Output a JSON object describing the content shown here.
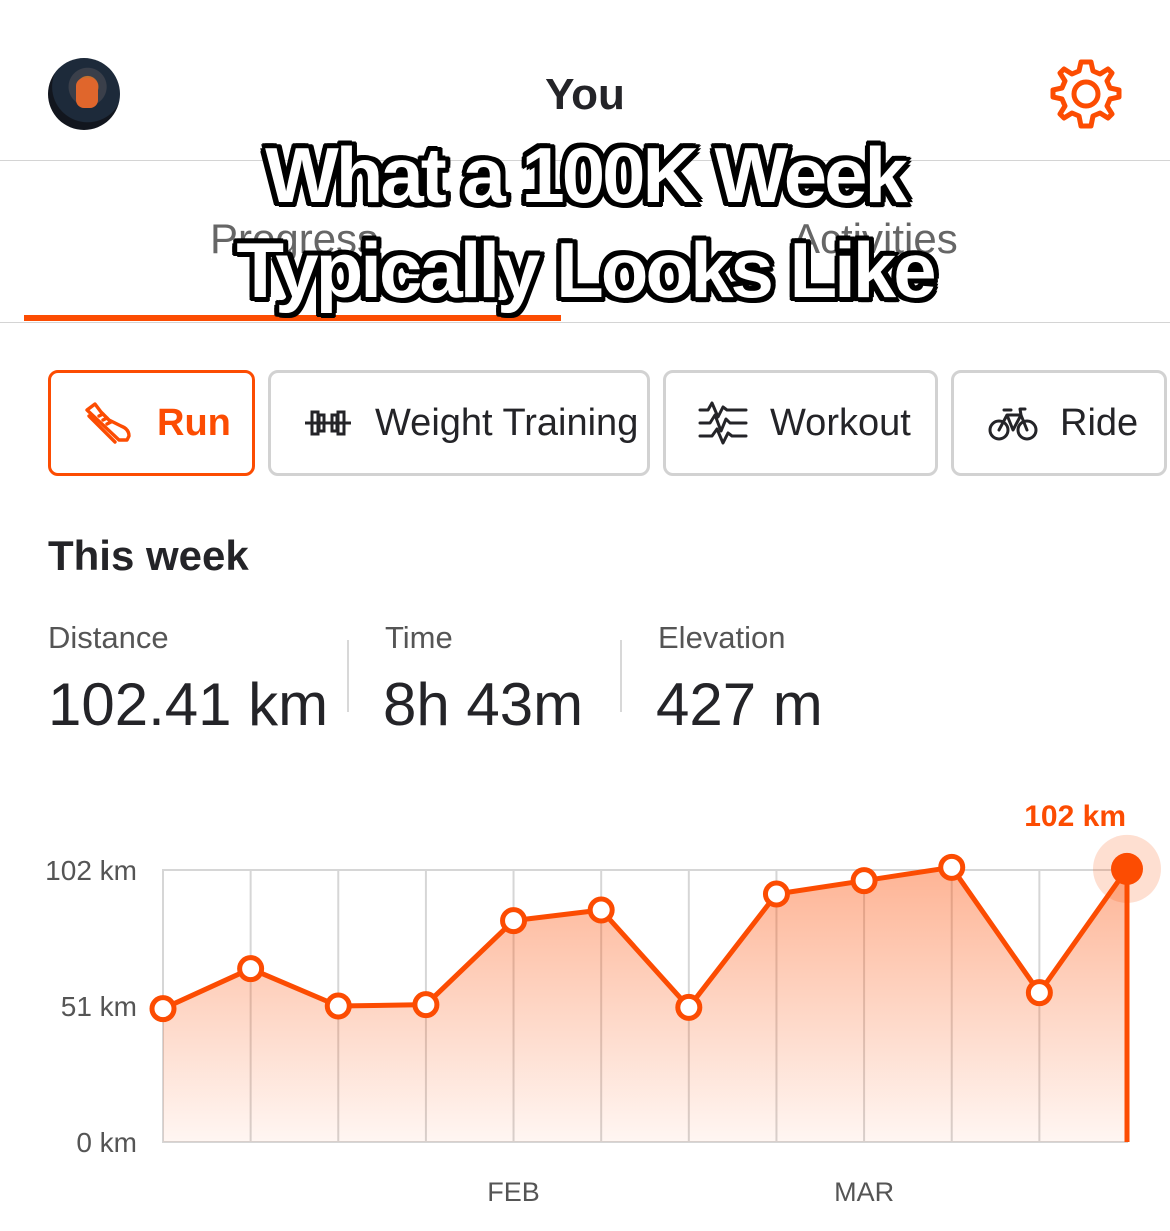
{
  "header": {
    "title": "You"
  },
  "overlay": {
    "line1": "What a 100K Week",
    "line2": "Typically Looks Like"
  },
  "tabs": [
    {
      "label": "Progress",
      "active": true
    },
    {
      "label": "Activities",
      "active": false
    }
  ],
  "sport_filters": [
    {
      "label": "Run",
      "icon": "shoe-icon",
      "selected": true
    },
    {
      "label": "Weight Training",
      "icon": "dumbbell-icon",
      "selected": false
    },
    {
      "label": "Workout",
      "icon": "workout-wave-icon",
      "selected": false
    },
    {
      "label": "Ride",
      "icon": "bike-icon",
      "selected": false
    }
  ],
  "this_week": {
    "title": "This week",
    "stats": [
      {
        "label": "Distance",
        "value": "102.41 km"
      },
      {
        "label": "Time",
        "value": "8h 43m"
      },
      {
        "label": "Elevation",
        "value": "427 m"
      }
    ]
  },
  "colors": {
    "accent": "#fc4c02",
    "text": "#242428",
    "muted": "#666666",
    "border": "#d2d2d2"
  },
  "chart_data": {
    "type": "area",
    "title": "",
    "xlabel": "",
    "ylabel": "",
    "y_ticks": [
      "102 km",
      "51 km",
      "0 km"
    ],
    "x_tick_labels": [
      {
        "label": "FEB",
        "at_week": 4
      },
      {
        "label": "MAR",
        "at_week": 8
      }
    ],
    "ylim": [
      0,
      102
    ],
    "weeks": 12,
    "series": [
      {
        "values": [
          50,
          65,
          51,
          51.5,
          83,
          87,
          50.5,
          93,
          98,
          103,
          56,
          102.41
        ]
      }
    ],
    "highlight": {
      "index": 11,
      "label": "102 km"
    },
    "grid": true
  }
}
